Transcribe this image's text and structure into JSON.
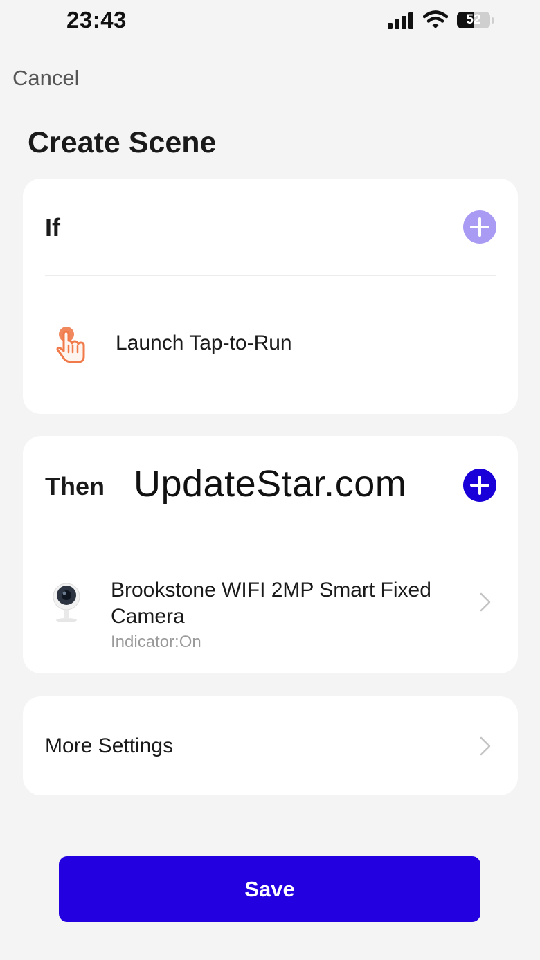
{
  "status_bar": {
    "time": "23:43",
    "battery_level": "52",
    "battery_fraction": 0.52,
    "icons": [
      "signal-icon",
      "wifi-icon",
      "battery-icon"
    ]
  },
  "header": {
    "cancel_label": "Cancel",
    "title": "Create Scene"
  },
  "if_section": {
    "heading": "If",
    "add_icon": "plus-icon",
    "add_color": "#a99bf3",
    "condition": {
      "icon": "tap-hand-icon",
      "icon_color": "#f07a4a",
      "label": "Launch Tap-to-Run"
    }
  },
  "then_section": {
    "heading": "Then",
    "watermark": "UpdateStar.com",
    "add_icon": "plus-icon",
    "add_color": "#1a00d8",
    "action": {
      "icon": "camera-icon",
      "title": "Brookstone WIFI 2MP Smart Fixed Camera",
      "subtitle": "Indicator:On"
    }
  },
  "more_settings": {
    "label": "More Settings",
    "icon": "chevron-right-icon"
  },
  "save": {
    "label": "Save",
    "color": "#2200e0"
  }
}
